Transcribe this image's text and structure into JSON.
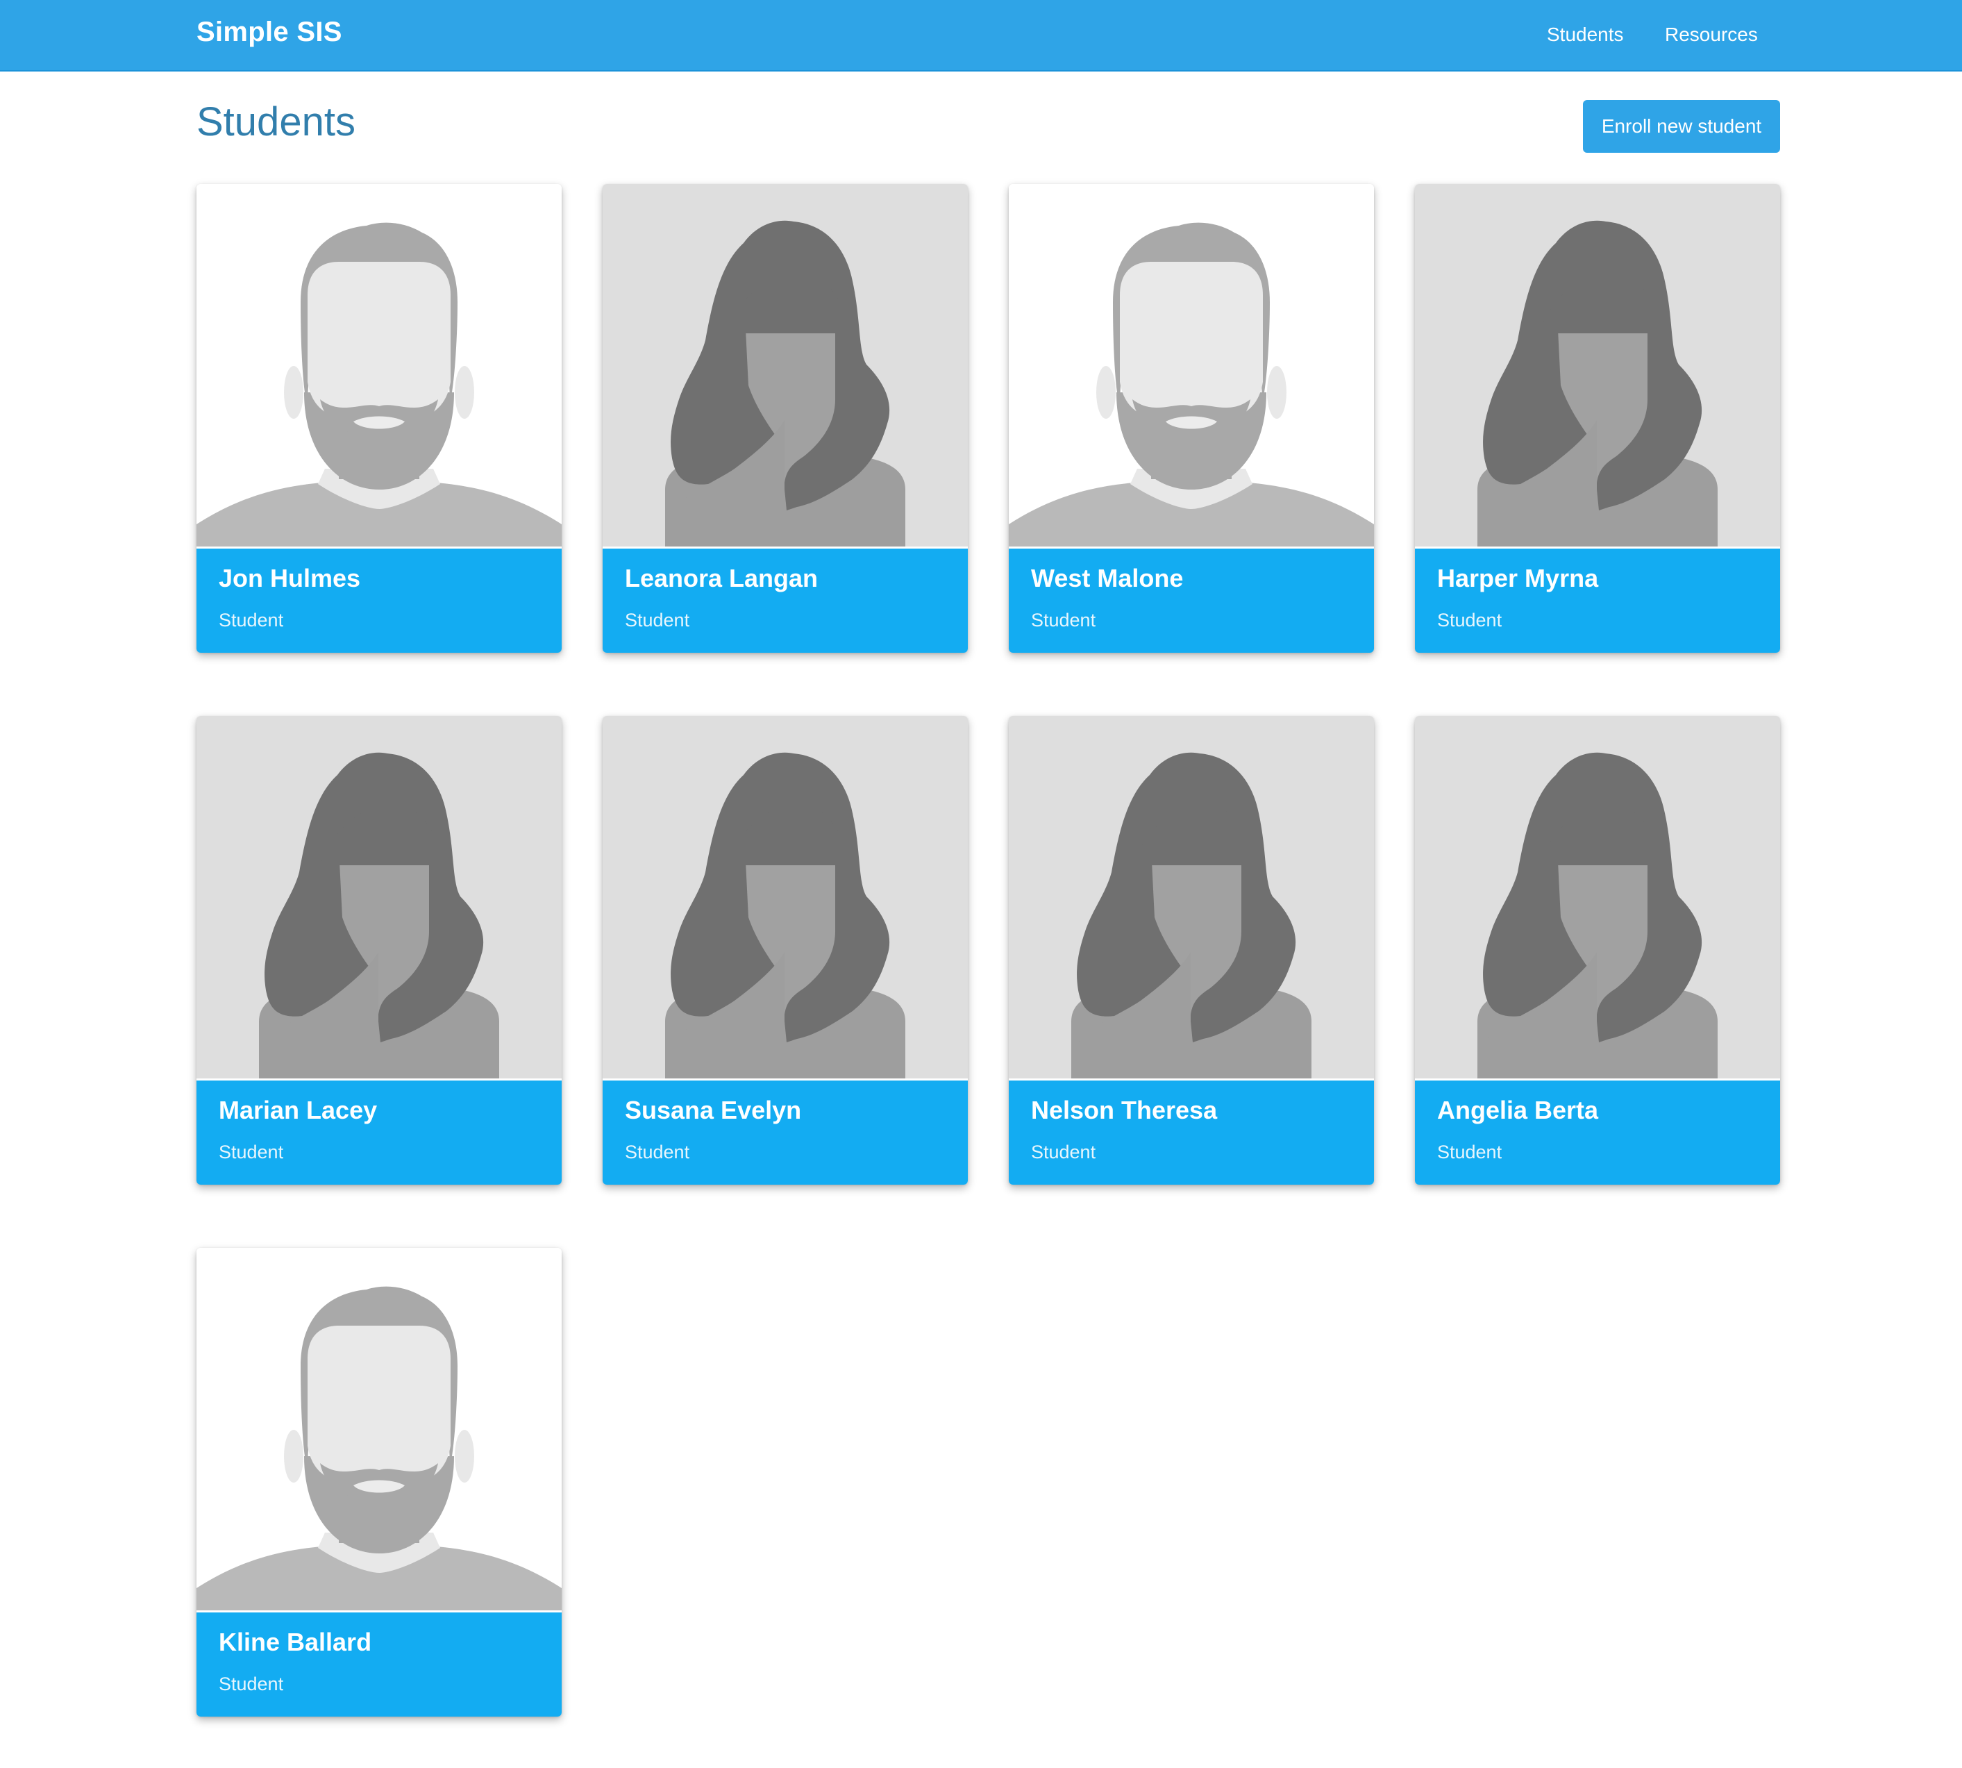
{
  "navbar": {
    "brand": "Simple SIS",
    "links": [
      {
        "label": "Students"
      },
      {
        "label": "Resources"
      }
    ],
    "background_color": "#2fa4e7"
  },
  "main": {
    "title": "Students",
    "enroll_button_label": "Enroll new student",
    "students": [
      {
        "name": "Jon Hulmes",
        "role": "Student",
        "avatar": "male-avatar-icon"
      },
      {
        "name": "Leanora Langan",
        "role": "Student",
        "avatar": "female-avatar-icon"
      },
      {
        "name": "West Malone",
        "role": "Student",
        "avatar": "male-avatar-icon"
      },
      {
        "name": "Harper Myrna",
        "role": "Student",
        "avatar": "female-avatar-icon"
      },
      {
        "name": "Marian Lacey",
        "role": "Student",
        "avatar": "female-avatar-icon"
      },
      {
        "name": "Susana Evelyn",
        "role": "Student",
        "avatar": "female-avatar-icon"
      },
      {
        "name": "Nelson Theresa",
        "role": "Student",
        "avatar": "female-avatar-icon"
      },
      {
        "name": "Angelia Berta",
        "role": "Student",
        "avatar": "female-avatar-icon"
      },
      {
        "name": "Kline Ballard",
        "role": "Student",
        "avatar": "male-avatar-icon"
      }
    ],
    "caption_color": "#13acf2",
    "title_color": "#317eac"
  }
}
